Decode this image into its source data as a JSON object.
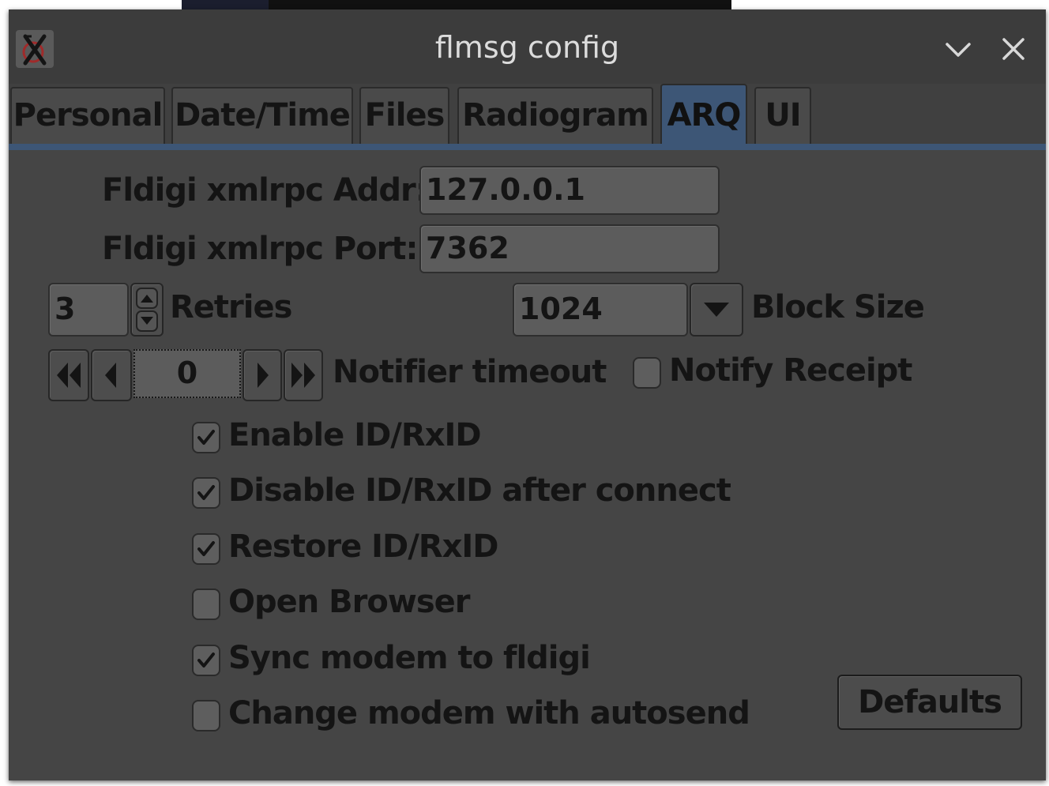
{
  "window": {
    "title": "flmsg config",
    "icons": {
      "app": "x11-app-icon",
      "minimize": "chevron-down-icon",
      "close": "close-icon"
    }
  },
  "tabs": [
    {
      "label": "Personal",
      "active": false
    },
    {
      "label": "Date/Time",
      "active": false
    },
    {
      "label": "Files",
      "active": false
    },
    {
      "label": "Radiogram",
      "active": false
    },
    {
      "label": "ARQ",
      "active": true
    },
    {
      "label": "UI",
      "active": false
    }
  ],
  "arq": {
    "xmlrpc_addr_label": "Fldigi xmlrpc Addr:",
    "xmlrpc_addr_value": "127.0.0.1",
    "xmlrpc_port_label": "Fldigi xmlrpc Port:",
    "xmlrpc_port_value": "7362",
    "retries_value": "3",
    "retries_label": "Retries",
    "block_size_value": "1024",
    "block_size_label": "Block Size",
    "notifier_value": "0",
    "notifier_label": "Notifier timeout",
    "notify_receipt_label": "Notify Receipt",
    "notify_receipt_checked": false,
    "options": [
      {
        "label": "Enable ID/RxID",
        "checked": true
      },
      {
        "label": "Disable ID/RxID after connect",
        "checked": true
      },
      {
        "label": "Restore ID/RxID",
        "checked": true
      },
      {
        "label": "Open Browser",
        "checked": false
      },
      {
        "label": "Sync modem to fldigi",
        "checked": true
      },
      {
        "label": "Change modem with autosend",
        "checked": false
      }
    ],
    "defaults_label": "Defaults"
  },
  "colors": {
    "window_bg": "#454545",
    "active_tab": "#3d5676",
    "text": "#141414"
  }
}
